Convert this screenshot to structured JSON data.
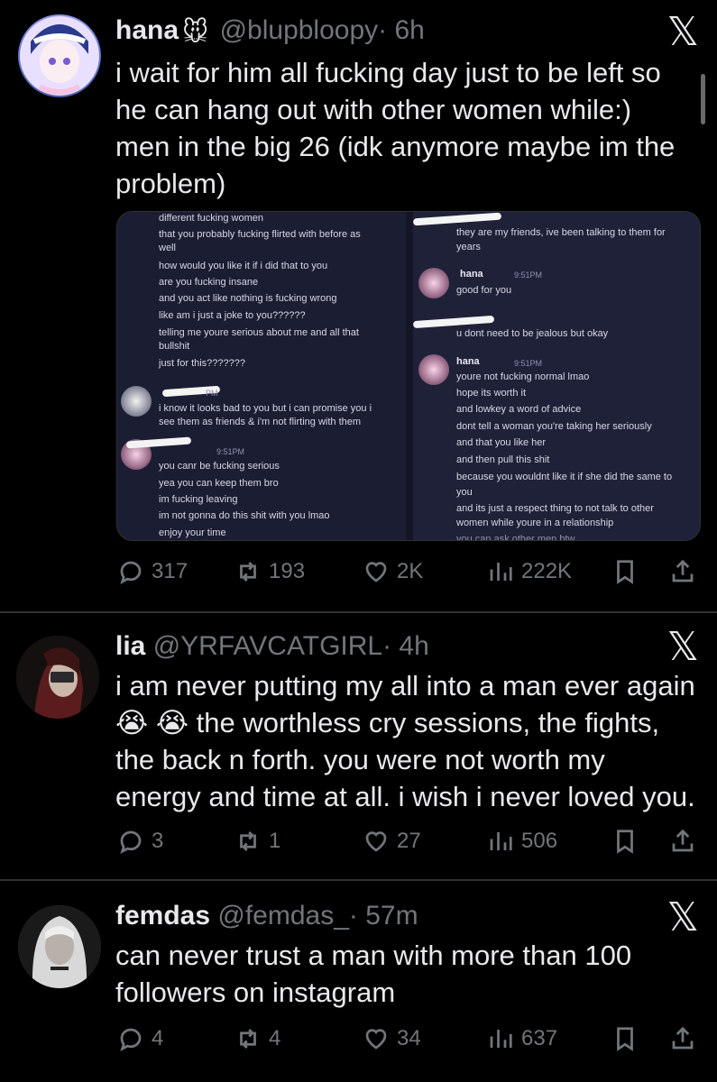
{
  "tweets": [
    {
      "name": "hana",
      "name_emoji": "🐭",
      "handle": "@blupbloopy",
      "time": "· 6h",
      "text": "i wait for him all fucking day just to be left so he can hang out with other women while:) men in the big 26 (idk anymore maybe im the problem)",
      "lines": [
        "i wait for him all fucking day just to be left so",
        "he can hang out with other women while:)",
        "men in the big 26 (idk anymore maybe im the",
        "problem)"
      ],
      "replies": "317",
      "reposts": "193",
      "likes": "2K",
      "views": "222K",
      "media": {
        "left_lines_top": [
          "different fucking women",
          "that you probably fucking flirted with before as",
          "well",
          "how would you like it if i did that to you",
          "are you fucking insane",
          "and you act like nothing is fucking wrong",
          "like am i just a joke to you??????",
          "telling me youre serious about me and all that",
          "bullshit",
          "just for this???????"
        ],
        "left_time_1": "PM",
        "left_lines_mid": [
          "i know it looks bad to you but i can promise you i",
          "see them as friends & i'm not flirting with them"
        ],
        "left_time_2": "9:51PM",
        "left_lines_bottom": [
          "you canr be fucking serious",
          "yea you can keep them bro",
          "im fucking leaving",
          "im not gonna do this shit with you lmao",
          "enjoy your time"
        ],
        "right_lines_top": [
          "they are my friends, ive been talking to them for",
          "years"
        ],
        "right_name_1": "hana",
        "right_time_1": "9:51PM",
        "right_line_1": "good for you",
        "right_line_2": "u dont need to be jealous but okay",
        "right_name_2": "hana",
        "right_time_2": "9:51PM",
        "right_lines_bottom": [
          "youre not fucking normal lmao",
          "hope its worth it",
          "and lowkey a word of advice",
          "dont tell a woman you're taking her seriously",
          "and that you like her",
          "and then pull this shit",
          "because you wouldnt like it if she did the same to",
          "you",
          "and its just a respect thing to not talk to other",
          "women while youre in a relationship",
          "you can ask other men btw"
        ]
      }
    },
    {
      "name": "lia",
      "handle": "@YRFAVCATGIRL",
      "time": "· 4h",
      "lines": [
        "i am never putting my all into a man ever again",
        "😭 😭 the worthless cry sessions, the fights,",
        "the back n forth. you were not worth my",
        "energy and time at all. i wish i never loved you."
      ],
      "replies": "3",
      "reposts": "1",
      "likes": "27",
      "views": "506"
    },
    {
      "name": "femdas",
      "handle": "@femdas_",
      "time": "· 57m",
      "lines": [
        "can never trust a man with more than 100",
        "followers on instagram"
      ],
      "replies": "4",
      "reposts": "4",
      "likes": "34",
      "views": "637"
    }
  ],
  "icons": {
    "close": "x-logo-icon",
    "reply": "reply-icon",
    "repost": "repost-icon",
    "like": "heart-icon",
    "views": "views-icon",
    "bookmark": "bookmark-icon",
    "share": "share-icon"
  },
  "colors": {
    "background": "#000000",
    "text": "#e7e9ea",
    "muted": "#71767b",
    "divider": "#2f3336"
  }
}
